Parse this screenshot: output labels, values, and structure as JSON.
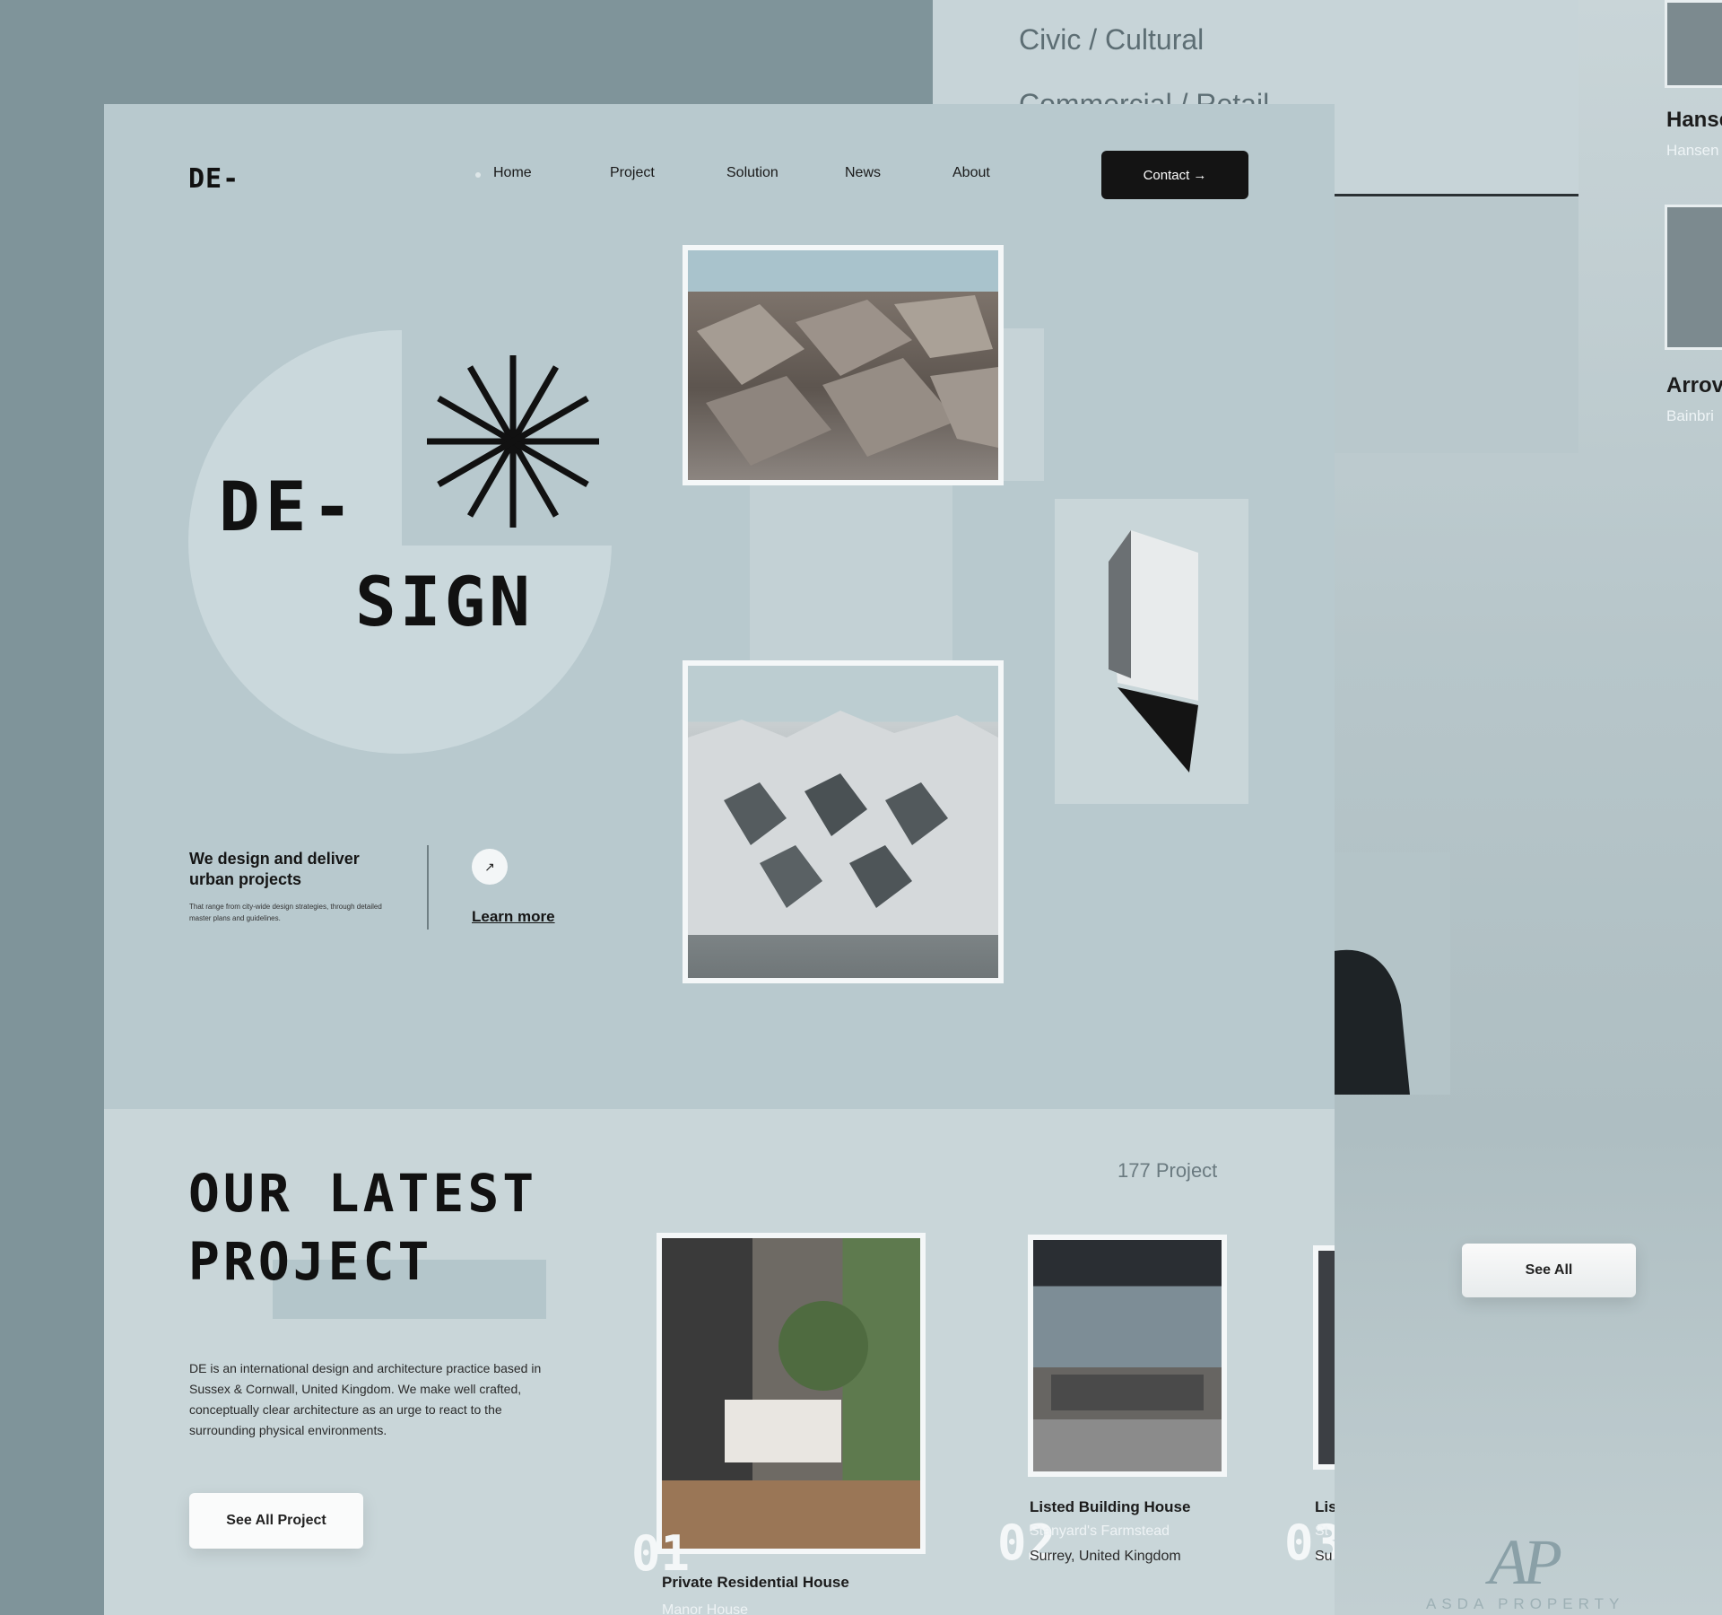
{
  "background_page": {
    "categories": [
      "Civic / Cultural",
      "Commercial / Retail"
    ],
    "projects": [
      {
        "name": "Hanse",
        "sub": "Hansen"
      },
      {
        "name": "Arrov",
        "sub": "Bainbri"
      }
    ],
    "see_all_label": "See All",
    "partner_logo": {
      "mark": "AP",
      "name": "ASDA PROPERTY"
    }
  },
  "header": {
    "logo": "DE-",
    "nav": [
      "Home",
      "Project",
      "Solution",
      "News",
      "About"
    ],
    "contact_label": "Contact →"
  },
  "hero": {
    "title_line1": "DE-",
    "title_line2": "SIGN",
    "tagline": "We design and deliver urban  projects",
    "small_text": "That range from city-wide  design strategies, through detailed  master plans and guidelines.",
    "learn_more": "Learn more",
    "arrow_icon": "↗"
  },
  "latest": {
    "title_line1": "OUR LATEST",
    "title_line2": "PROJECT",
    "count": "177 Project",
    "description": "DE is an international design and architecture practice based in Sussex & Cornwall, United Kingdom. We make well crafted, conceptually clear architecture as an urge to react to the surrounding physical environments.",
    "see_all_label": "See All Project",
    "projects": [
      {
        "num": "01",
        "title": "Private Residential House",
        "sub1": "Manor House",
        "sub2": ""
      },
      {
        "num": "02",
        "title": "Listed Building House",
        "sub1": "Stanyard's Farmstead",
        "sub2": "Surrey, United Kingdom"
      },
      {
        "num": "03",
        "title": "Lis",
        "sub1": "St",
        "sub2": "Su"
      }
    ]
  },
  "colors": {
    "accent": "#141414",
    "page": "#b8c9ce",
    "backdrop": "#7f949a"
  }
}
